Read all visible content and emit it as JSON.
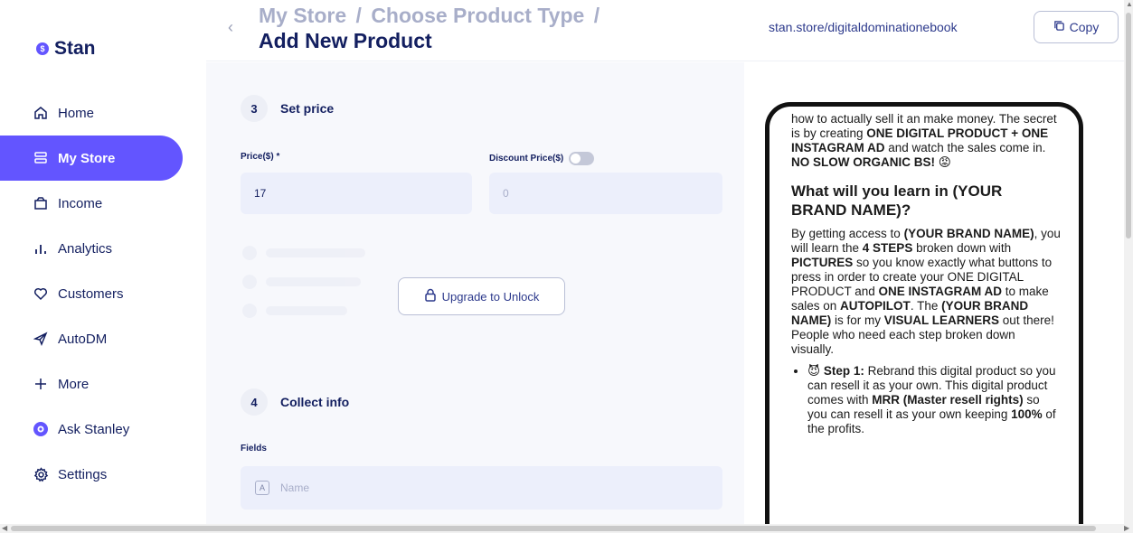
{
  "sidebar": {
    "brand": "Stan",
    "items": [
      {
        "label": "Home",
        "icon": "home-icon"
      },
      {
        "label": "My Store",
        "icon": "store-icon",
        "active": true
      },
      {
        "label": "Income",
        "icon": "wallet-icon"
      },
      {
        "label": "Analytics",
        "icon": "analytics-icon"
      },
      {
        "label": "Customers",
        "icon": "heart-icon"
      },
      {
        "label": "AutoDM",
        "icon": "send-icon"
      },
      {
        "label": "More",
        "icon": "plus-icon"
      },
      {
        "label": "Ask Stanley",
        "icon": "stanley-icon"
      },
      {
        "label": "Settings",
        "icon": "gear-icon"
      }
    ]
  },
  "header": {
    "breadcrumb_1": "My Store",
    "breadcrumb_sep": "/",
    "breadcrumb_2": "Choose Product Type",
    "title": "Add New Product",
    "store_url": "stan.store/digitaldominationebook",
    "copy_label": "Copy"
  },
  "price_section": {
    "number": "3",
    "title": "Set price",
    "price_label": "Price($) *",
    "price_value": "17",
    "discount_label": "Discount Price($)",
    "discount_placeholder": "0",
    "discount_enabled": false,
    "upgrade_label": "Upgrade to Unlock"
  },
  "collect_section": {
    "number": "4",
    "title": "Collect info",
    "fields_label": "Fields",
    "name_icon_text": "A",
    "name_label": "Name"
  },
  "preview": {
    "p1_a": "how to actually sell it an make money. The secret is by creating ",
    "p1_b": "ONE DIGITAL PRODUCT + ONE INSTAGRAM AD",
    "p1_c": " and watch the sales come in. ",
    "p1_d": "NO SLOW ORGANIC BS!",
    "p1_emoji": "😡",
    "heading": "What will you learn in (YOUR BRAND NAME)?",
    "p2_a": "By getting access to ",
    "p2_b": "(YOUR BRAND NAME)",
    "p2_c": ", you will learn the ",
    "p2_d": "4 STEPS",
    "p2_e": " broken down with ",
    "p2_f": "PICTURES",
    "p2_g": " so you know exactly what buttons to press in order to create your ONE DIGITAL PRODUCT and ",
    "p2_h": "ONE INSTAGRAM AD",
    "p2_i": " to make sales on ",
    "p2_j": "AUTOPILOT",
    "p2_k": ". The ",
    "p2_l": "(YOUR BRAND NAME)",
    "p2_m": " is for my ",
    "p2_n": "VISUAL LEARNERS",
    "p2_o": " out there! People who need each step broken down visually.",
    "li_emoji": "😈",
    "li_a": "Step 1:",
    "li_b": " Rebrand this digital product so you can resell it as your own. This digital product comes with ",
    "li_c": "MRR (Master resell rights)",
    "li_d": " so you can resell it as your own keeping ",
    "li_e": "100%",
    "li_f": " of the profits."
  }
}
